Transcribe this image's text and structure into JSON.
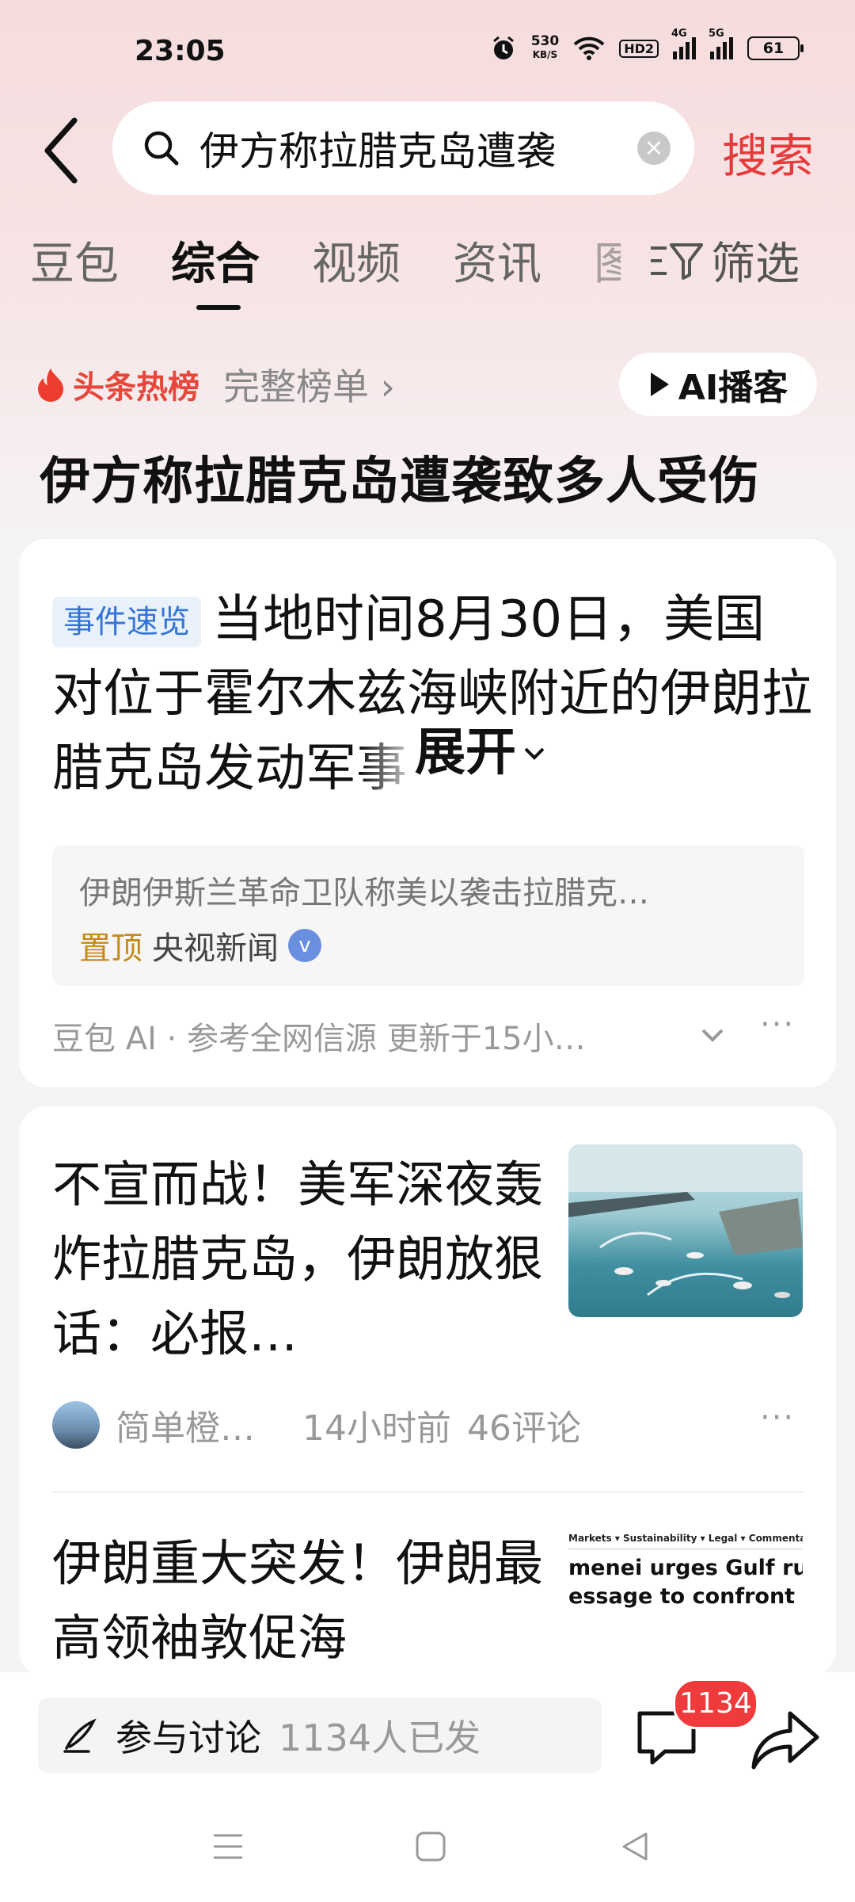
{
  "status": {
    "time": "23:05",
    "speed_value": "530",
    "speed_unit": "KB/S",
    "hd": "HD2",
    "sig1": "4G",
    "sig2": "5G",
    "battery": "61"
  },
  "search": {
    "query": "伊方称拉腊克岛遭袭",
    "button": "搜索"
  },
  "tabs": [
    "豆包",
    "综合",
    "视频",
    "资讯",
    "图"
  ],
  "tab_active": "综合",
  "filter": "筛选",
  "hot": {
    "label": "头条热榜",
    "full": "完整榜单 ›",
    "ai": "AI播客"
  },
  "headline": "伊方称拉腊克岛遭袭致多人受伤",
  "summary": {
    "badge": "事件速览",
    "text": "当地时间8月30日，美国对位于霍尔木兹海峡附近的伊朗拉腊克岛发动军事",
    "expand": "展开",
    "sub_text": "伊朗伊斯兰革命卫队称美以袭击拉腊克…",
    "pinned": "置顶",
    "source": "央视新闻",
    "meta": "豆包 AI · 参考全网信源 更新于15小…"
  },
  "news": [
    {
      "title": "不宣而战！美军深夜轰炸拉腊克岛，伊朗放狠话：必报…",
      "author": "简单橙…",
      "time": "14小时前",
      "comments": "46评论"
    },
    {
      "title": "伊朗重大突发！伊朗最高领袖敦促海",
      "thumb_nav": "Markets ▾   Sustainability ▾   Legal ▾   Commentary",
      "thumb_line1": "menei urges Gulf rul",
      "thumb_line2": "essage to confront 're"
    }
  ],
  "bottom": {
    "discuss_label": "参与讨论",
    "discuss_count": "1134人已发",
    "comment_badge": "1134"
  }
}
